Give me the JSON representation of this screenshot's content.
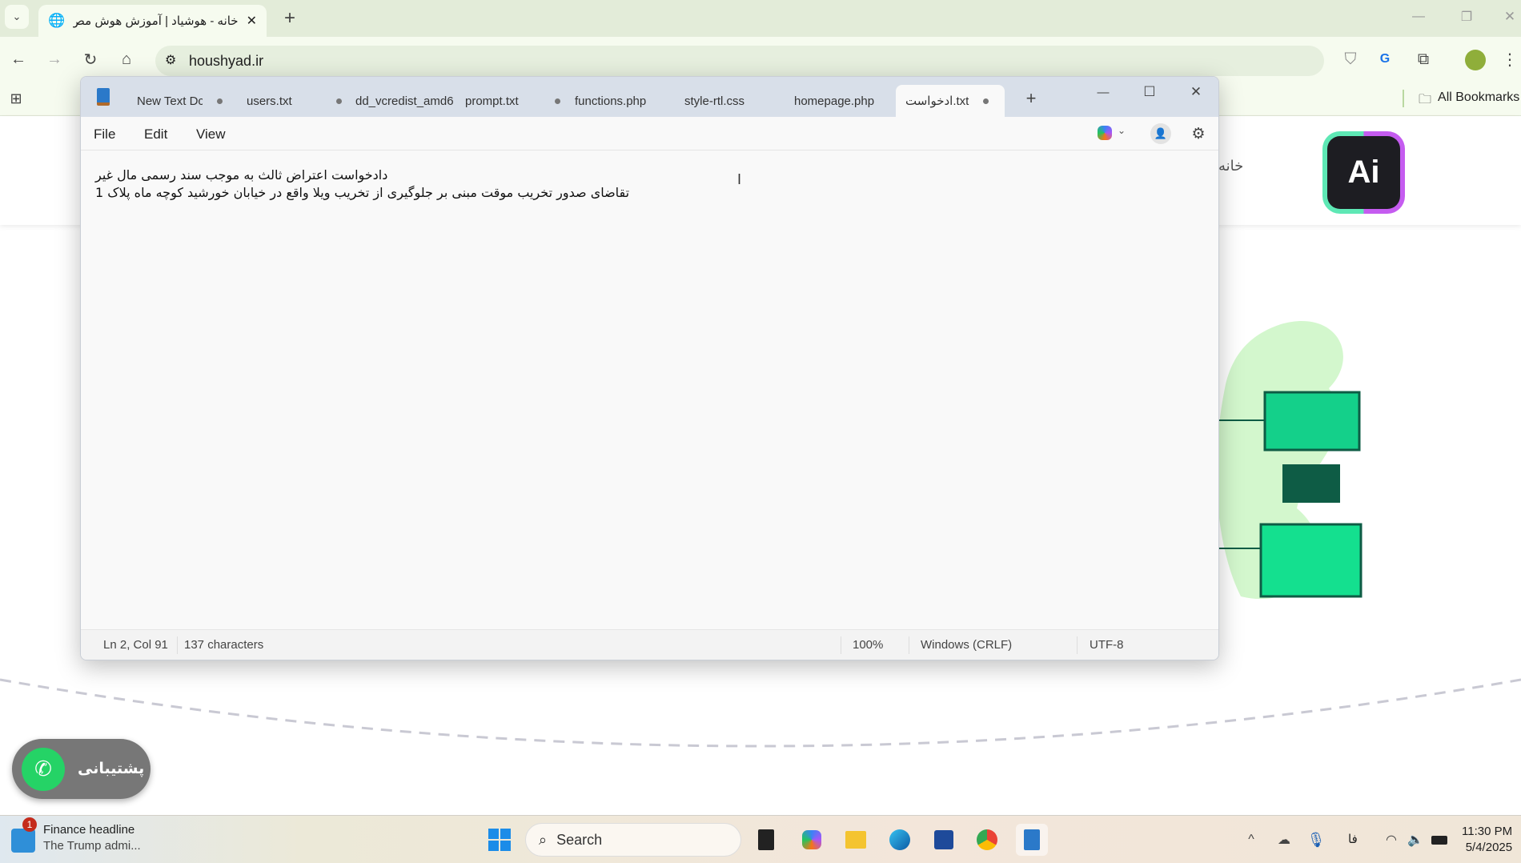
{
  "browser": {
    "tab_title": "خانه - هوشیاد | آموزش هوش مص",
    "url": "houshyad.ir",
    "all_bookmarks": "All Bookmarks"
  },
  "page": {
    "nav_home": "خانه",
    "support_label": "پشتیبانی",
    "logo_text": "Ai"
  },
  "notepad": {
    "tabs": [
      {
        "label": "New Text Dc",
        "modified": true
      },
      {
        "label": "users.txt",
        "modified": true
      },
      {
        "label": "dd_vcredist_amd6",
        "modified": false
      },
      {
        "label": "prompt.txt",
        "modified": true
      },
      {
        "label": "functions.php",
        "modified": false
      },
      {
        "label": "style-rtl.css",
        "modified": false
      },
      {
        "label": "homepage.php",
        "modified": false
      },
      {
        "label": "ادخواست.txt",
        "modified": true,
        "active": true
      }
    ],
    "menu": [
      "File",
      "Edit",
      "View"
    ],
    "lines": [
      "دادخواست اعتراض ثالث به موجب سند رسمی مال غیر",
      "تقاضای صدور تخریب موقت مبنی بر جلوگیری از تخریب ویلا واقع در خیابان خورشید کوچه ماه پلاک 1"
    ],
    "status": {
      "position": "Ln 2, Col 91",
      "chars": "137 characters",
      "zoom": "100%",
      "line_ending": "Windows (CRLF)",
      "encoding": "UTF-8"
    }
  },
  "taskbar": {
    "news_title": "Finance headline",
    "news_sub": "The Trump admi...",
    "news_badge": "1",
    "search": "Search",
    "lang": "فا",
    "time": "11:30 PM",
    "date": "5/4/2025"
  }
}
